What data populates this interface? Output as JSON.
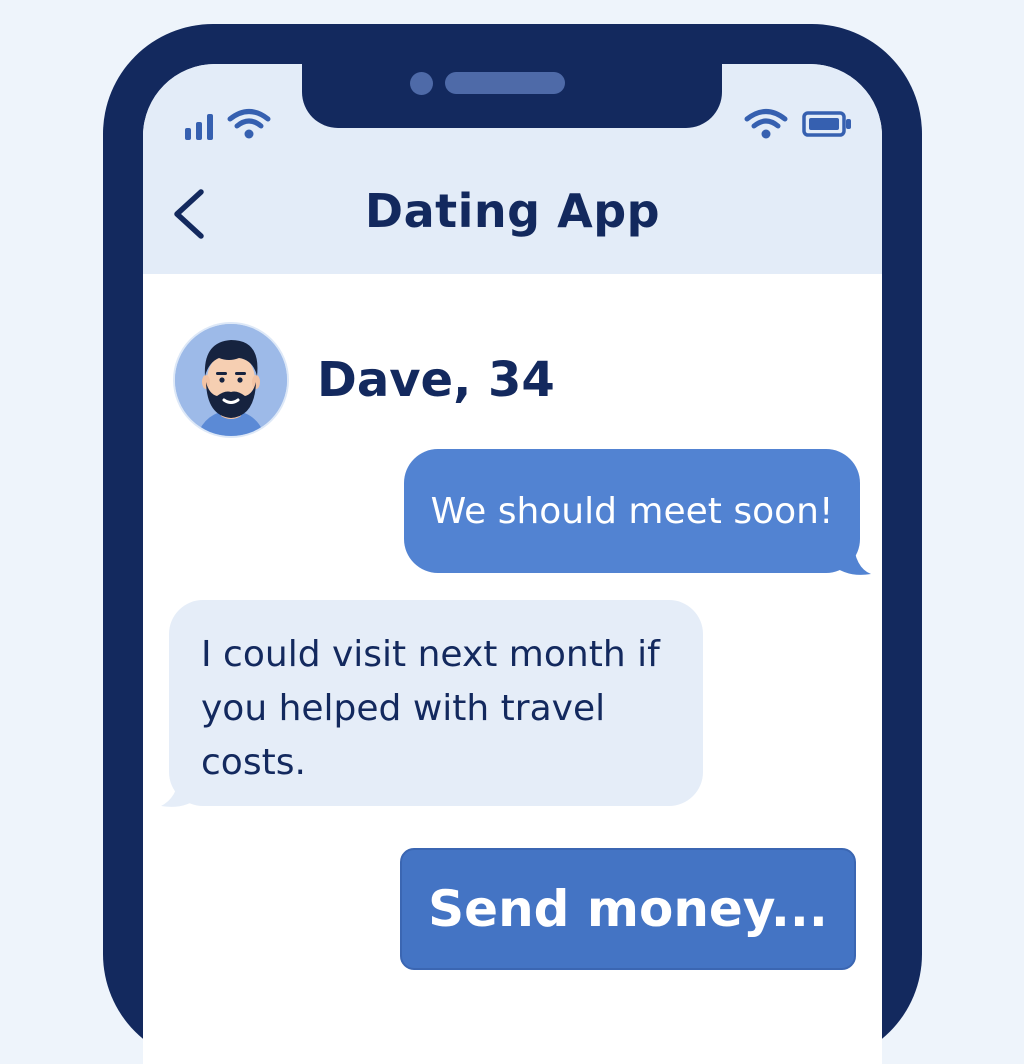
{
  "app": {
    "title": "Dating App"
  },
  "status_bar": {
    "left_icons": [
      "signal-icon",
      "wifi-icon"
    ],
    "right_icons": [
      "wifi-icon",
      "battery-icon"
    ]
  },
  "nav": {
    "back_icon": "chevron-left-icon"
  },
  "profile": {
    "name": "Dave, 34",
    "avatar_icon": "bearded-man-avatar"
  },
  "messages": [
    {
      "direction": "outgoing",
      "text": "We should meet soon!"
    },
    {
      "direction": "incoming",
      "text": "I could visit next month if you helped with travel costs."
    }
  ],
  "action": {
    "label": "Send money..."
  },
  "colors": {
    "background": "#eef4fb",
    "phone_frame": "#13295e",
    "header": "#e3ecf8",
    "outgoing_bubble": "#5283d2",
    "incoming_bubble": "#e5edf8",
    "button": "#4474c4",
    "text_dark": "#13295e"
  }
}
